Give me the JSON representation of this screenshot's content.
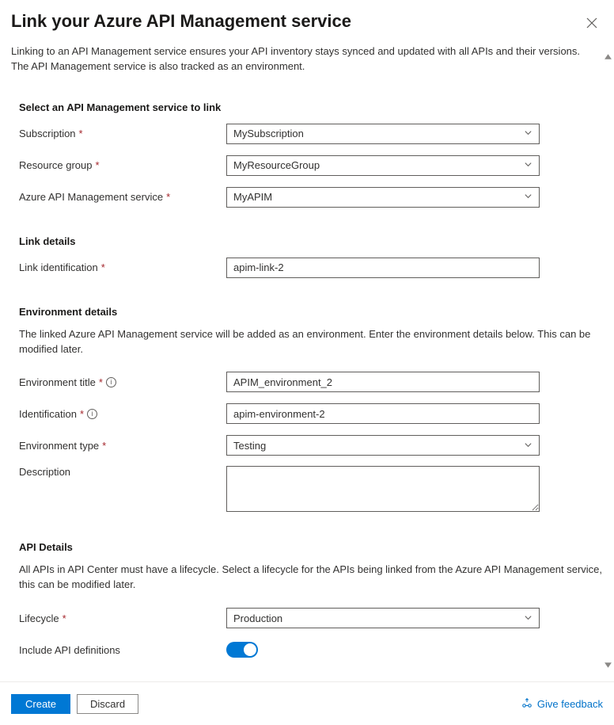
{
  "header": {
    "title": "Link your Azure API Management service"
  },
  "intro": "Linking to an API Management service ensures your API inventory stays synced and updated with all APIs and their versions. The API Management service is also tracked as an environment.",
  "select_service": {
    "heading": "Select an API Management service to link",
    "subscription_label": "Subscription",
    "subscription_value": "MySubscription",
    "rg_label": "Resource group",
    "rg_value": "MyResourceGroup",
    "apim_label": "Azure API Management service",
    "apim_value": "MyAPIM"
  },
  "link_details": {
    "heading": "Link details",
    "link_id_label": "Link identification",
    "link_id_value": "apim-link-2"
  },
  "env_details": {
    "heading": "Environment details",
    "desc": "The linked Azure API Management service will be added as an environment. Enter the environment details below. This can be modified later.",
    "title_label": "Environment title",
    "title_value": "APIM_environment_2",
    "id_label": "Identification",
    "id_value": "apim-environment-2",
    "type_label": "Environment type",
    "type_value": "Testing",
    "description_label": "Description",
    "description_value": ""
  },
  "api_details": {
    "heading": "API Details",
    "desc": "All APIs in API Center must have a lifecycle. Select a lifecycle for the APIs being linked from the Azure API Management service, this can be modified later.",
    "lifecycle_label": "Lifecycle",
    "lifecycle_value": "Production",
    "include_defs_label": "Include API definitions"
  },
  "footer": {
    "create_label": "Create",
    "discard_label": "Discard",
    "feedback_label": "Give feedback"
  }
}
